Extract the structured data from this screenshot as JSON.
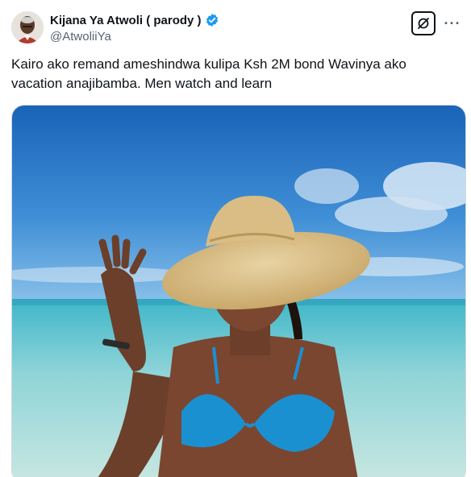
{
  "author": {
    "display_name": "Kijana Ya Atwoli ( parody )",
    "handle": "@AtwoliiYa",
    "verified": true,
    "verified_color": "#1d9bf0"
  },
  "tweet": {
    "text": "Kairo ako remand ameshindwa kulipa Ksh 2M bond Wavinya ako vacation anajibamba. Men watch and learn"
  },
  "actions": {
    "grok_icon": "grok-icon",
    "more_icon": "more-icon",
    "more_label": "···"
  },
  "media": {
    "type": "photo",
    "description_icon": "photo-image"
  }
}
